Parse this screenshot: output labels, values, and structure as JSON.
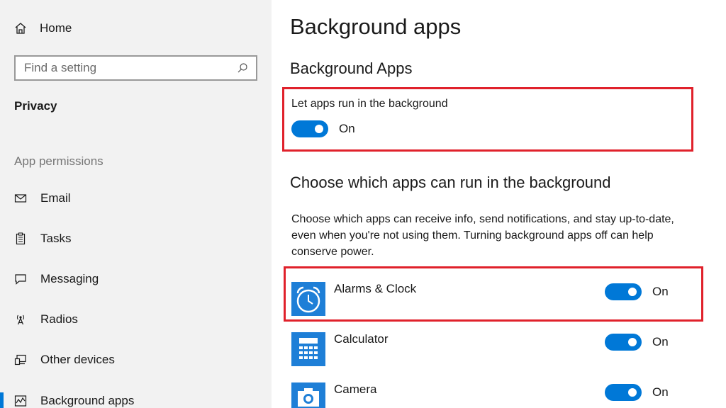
{
  "sidebar": {
    "home_label": "Home",
    "search_placeholder": "Find a setting",
    "section_title": "Privacy",
    "group_label": "App permissions",
    "items": [
      {
        "label": "Email",
        "icon": "mail-icon"
      },
      {
        "label": "Tasks",
        "icon": "clipboard-icon"
      },
      {
        "label": "Messaging",
        "icon": "chat-icon"
      },
      {
        "label": "Radios",
        "icon": "antenna-icon"
      },
      {
        "label": "Other devices",
        "icon": "devices-icon"
      },
      {
        "label": "Background apps",
        "icon": "activity-icon",
        "active": true
      }
    ]
  },
  "main": {
    "title": "Background apps",
    "subheading": "Background Apps",
    "master_toggle": {
      "label": "Let apps run in the background",
      "state": "On"
    },
    "choose_heading": "Choose which apps can run in the background",
    "description": "Choose which apps can receive info, send notifications, and stay up-to-date, even when you're not using them. Turning background apps off can help conserve power.",
    "apps": [
      {
        "name": "Alarms & Clock",
        "state": "On",
        "icon": "alarm-clock-icon"
      },
      {
        "name": "Calculator",
        "state": "On",
        "icon": "calculator-icon"
      },
      {
        "name": "Camera",
        "state": "On",
        "icon": "camera-icon"
      }
    ]
  },
  "colors": {
    "accent": "#0078d7",
    "highlight": "#e0212b",
    "sidebar_bg": "#f2f2f2"
  }
}
